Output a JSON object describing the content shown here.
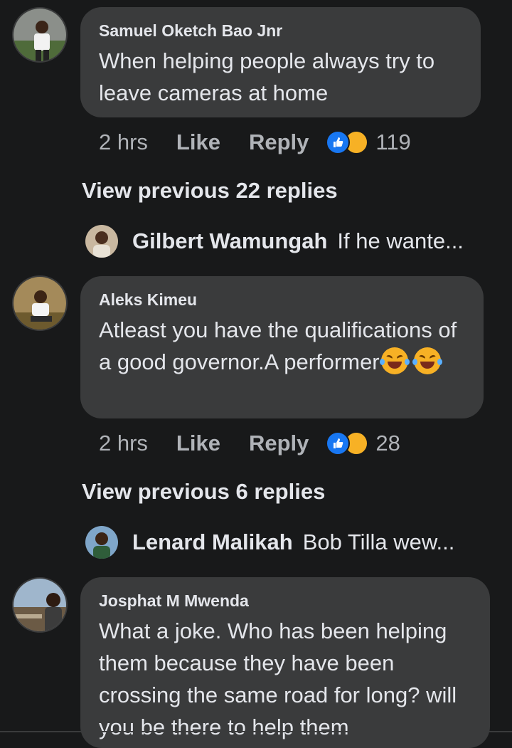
{
  "comments": [
    {
      "author": "Samuel Oketch Bao Jnr",
      "text": "When helping people always try to leave cameras at home",
      "time": "2 hrs",
      "like_label": "Like",
      "reply_label": "Reply",
      "reaction_count": "119",
      "reactions": [
        "like-icon",
        "haha-icon"
      ]
    },
    {
      "author": "Aleks Kimeu",
      "text": "Atleast you have the qualifications of a good governor.A performer",
      "emojis": [
        "rofl-emoji",
        "rofl-emoji"
      ],
      "time": "2 hrs",
      "like_label": "Like",
      "reply_label": "Reply",
      "reaction_count": "28",
      "reactions": [
        "like-icon",
        "haha-icon"
      ]
    },
    {
      "author": "Josphat M Mwenda",
      "text": "What a joke. Who has been helping them because they have been crossing the same road for long? will you be there to help them"
    }
  ],
  "threads": [
    {
      "view_previous": "View previous 22 replies",
      "reply_author": "Gilbert Wamungah",
      "reply_snippet": "If he wante..."
    },
    {
      "view_previous": "View previous 6 replies",
      "reply_author": "Lenard Malikah",
      "reply_snippet": "Bob Tilla wew..."
    }
  ],
  "colors": {
    "background": "#18191a",
    "bubble": "#3a3b3c",
    "like_blue": "#1877f2",
    "haha_yellow": "#f7b125"
  }
}
